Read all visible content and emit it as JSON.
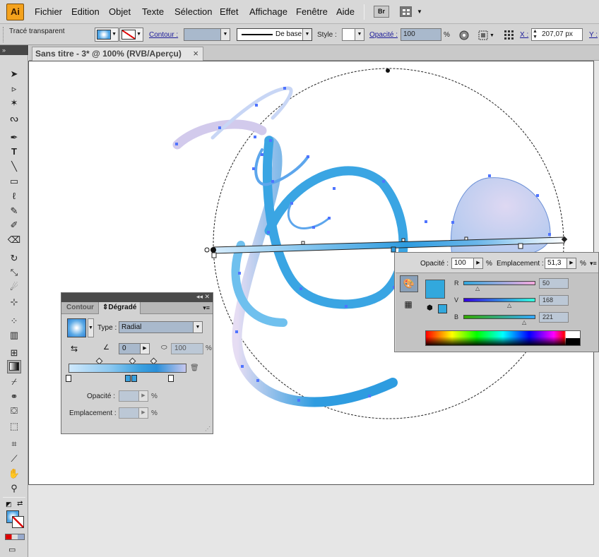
{
  "app": {
    "logo": "Ai",
    "menu": [
      "Fichier",
      "Edition",
      "Objet",
      "Texte",
      "Sélection",
      "Effet",
      "Affichage",
      "Fenêtre",
      "Aide"
    ],
    "bridge_label": "Br"
  },
  "control_bar": {
    "selection_label": "Tracé transparent",
    "stroke_label": "Contour :",
    "stroke_profile": "De base",
    "style_label": "Style :",
    "opacity_label": "Opacité :",
    "opacity_value": "100",
    "opacity_unit": "%",
    "x_label": "X :",
    "x_value": "207,07 px",
    "y_label": "Y :"
  },
  "toolbox": {
    "collapse_label": "»",
    "tools": [
      "selection",
      "direct-selection",
      "magic-wand",
      "lasso",
      "pen",
      "type",
      "line",
      "rectangle",
      "paintbrush",
      "pencil",
      "blob-brush",
      "eraser",
      "rotate",
      "scale",
      "warp",
      "free-transform",
      "symbol-sprayer",
      "graph",
      "mesh",
      "gradient",
      "eyedropper",
      "blend",
      "live-paint",
      "live-paint-selection",
      "artboard",
      "slice",
      "hand",
      "zoom"
    ]
  },
  "document": {
    "tab_title": "Sans titre - 3* @ 100% (RVB/Aperçu)",
    "close_label": "×"
  },
  "gradient_panel": {
    "tab_stroke": "Contour",
    "tab_gradient": "Dégradé",
    "type_label": "Type :",
    "type_value": "Radial",
    "angle_value": "0",
    "ratio_value": "100",
    "ratio_unit": "%",
    "opacity_label": "Opacité :",
    "opacity_unit": "%",
    "location_label": "Emplacement :",
    "location_unit": "%",
    "stops": [
      {
        "color": "#ffffff",
        "location": 0
      },
      {
        "color": "#3aa0dc",
        "location": 52
      },
      {
        "color": "#3aa0dc",
        "location": 56
      },
      {
        "color": "#ffffff",
        "location": 88
      }
    ]
  },
  "stop_popup": {
    "opacity_label": "Opacité :",
    "opacity_value": "100",
    "opacity_unit": "%",
    "location_label": "Emplacement :",
    "location_value": "51,3",
    "location_unit": "%",
    "color": "#32a8dd",
    "r_label": "R",
    "r_value": "50",
    "v_label": "V",
    "v_value": "168",
    "b_label": "B",
    "b_value": "221"
  },
  "colors": {
    "gradient_start": "#d8ccee",
    "gradient_mid": "#2d9be0",
    "selection": "#4f74ff"
  }
}
